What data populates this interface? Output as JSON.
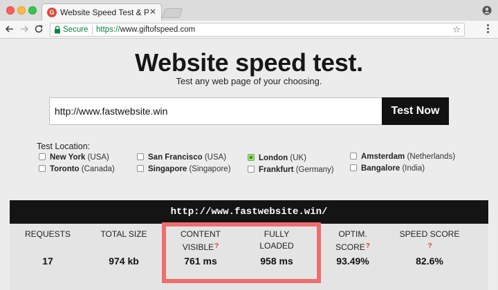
{
  "browser": {
    "tab_title": "Website Speed Test & Perform",
    "favicon_letter": "G",
    "secure_label": "Secure",
    "url_scheme": "https://",
    "url_host": "www.giftofspeed.com"
  },
  "hero": {
    "title": "Website speed test.",
    "subtitle": "Test any web page of your choosing."
  },
  "form": {
    "url_value": "http://www.fastwebsite.win",
    "submit_label": "Test Now"
  },
  "locations": {
    "title": "Test Location:",
    "items": [
      {
        "city": "New York",
        "country": "(USA)",
        "checked": false
      },
      {
        "city": "Toronto",
        "country": "(Canada)",
        "checked": false
      },
      {
        "city": "San Francisco",
        "country": "(USA)",
        "checked": false
      },
      {
        "city": "Singapore",
        "country": "(Singapore)",
        "checked": false
      },
      {
        "city": "London",
        "country": "(UK)",
        "checked": true
      },
      {
        "city": "Frankfurt",
        "country": "(Germany)",
        "checked": false
      },
      {
        "city": "Amsterdam",
        "country": "(Netherlands)",
        "checked": false
      },
      {
        "city": "Bangalore",
        "country": "(India)",
        "checked": false
      }
    ]
  },
  "results": {
    "tested_url": "http://www.fastwebsite.win/",
    "help_mark": "?",
    "metrics": [
      {
        "line1": "REQUESTS",
        "line2": "",
        "value": "17"
      },
      {
        "line1": "TOTAL SIZE",
        "line2": "",
        "value": "974 kb"
      },
      {
        "line1": "CONTENT",
        "line2": "VISIBLE",
        "value": "761 ms"
      },
      {
        "line1": "FULLY",
        "line2": "LOADED",
        "value": "958 ms"
      },
      {
        "line1": "OPTIM.",
        "line2": "SCORE",
        "value": "93.49%"
      },
      {
        "line1": "SPEED SCORE",
        "line2": "",
        "value": "82.6%"
      }
    ]
  },
  "colors": {
    "highlight_border": "#ef6d6d",
    "help_mark": "#e53935",
    "secure_green": "#0b8043",
    "checked_green": "#9be07a"
  }
}
